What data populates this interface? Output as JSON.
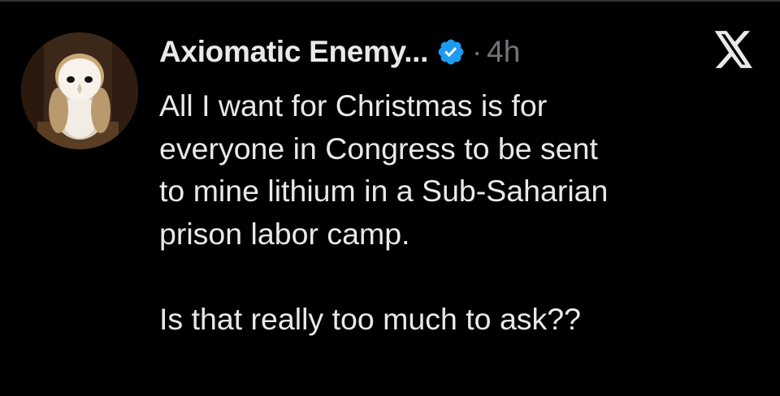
{
  "tweet": {
    "display_name": "Axiomatic Enemy...",
    "verified": true,
    "separator": "·",
    "time": "4h",
    "body_lines": [
      "All I want for Christmas is for",
      "everyone in Congress to be sent",
      "to mine lithium in a Sub-Saharian",
      "prison labor camp."
    ],
    "question": "Is that really too much to ask??"
  },
  "icons": {
    "verified": "verified-badge-icon",
    "logo": "x-logo-icon",
    "avatar": "owl-avatar"
  },
  "colors": {
    "background": "#000000",
    "text": "#e7e9ea",
    "muted": "#71767b",
    "verified": "#1d9bf0"
  }
}
